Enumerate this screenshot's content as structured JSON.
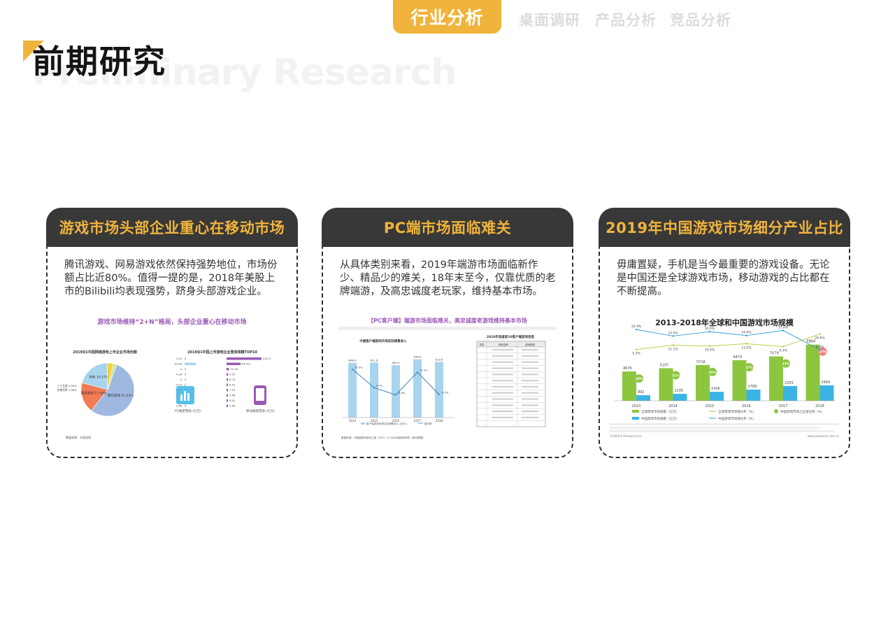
{
  "nav": {
    "active": "行业分析",
    "items": [
      "桌面调研",
      "产品分析",
      "竞品分析"
    ]
  },
  "header": {
    "title": "前期研究",
    "subtitle": "Preliminary Research"
  },
  "cards": [
    {
      "title": "游戏市场头部企业重心在移动市场",
      "text": "腾讯游戏、网易游戏依然保持强势地位，市场份额占比近80%。值得一提的是，2018年美股上市的Bilibili均表现强势，跻身头部游戏企业。",
      "figure": {
        "title": "游戏市场维持“2+N”格局，头部企业重心在移动市场",
        "left_title": "2019Q1中国网络游戏上市企业市场份额",
        "right_title": "2019Q1中国上市游戏企业营收规模TOP10",
        "pie_labels": [
          "腾讯游戏 51.53%",
          "网易游戏 17.45%",
          "其他 19.27%",
          "三七互娱 3.50%",
          "完美世界 1.98%"
        ],
        "bar_values": [
          "212.0",
          "85.44",
          "14.40",
          "9.20",
          "8.74",
          "6.01",
          "7.23",
          "3.58",
          "6.41",
          "3.65"
        ],
        "left_values": [
          "1.03",
          "33.06",
          "4",
          "4.26",
          "0",
          "2.03",
          "0.18",
          "4.15",
          "4",
          "2.68"
        ],
        "legend_pc": "PC端游营收 (亿元)",
        "legend_mobile": "移动端游营收 (亿元)",
        "source": "数据来源：艾瑞咨询"
      }
    },
    {
      "title": "PC端市场面临难关",
      "text": "从具体类别来看，2019年端游市场面临新作少、精品少的难关，18年末至今，仅靠优质的老牌端游，及高忠诚度老玩家，维持基本市场。",
      "figure": {
        "title": "【PC客户端】端游市场面临难关，高忠诚度老游戏维持基本市场",
        "chart_title": "中国客户端游戏市场实际销售收入",
        "table_title": "2018年热度前10客户端游戏信息",
        "table_headers": [
          "排名",
          "游戏名称",
          "游戏类型"
        ],
        "legend": [
          "客户端游戏市场实际销售收入 (亿元)",
          "增长率"
        ],
        "source": "数据来源：中国音数协游戏工委（GPC）& CNG中新游戏研究（伽马数据）"
      }
    },
    {
      "title": "2019年中国游戏市场细分产业占比",
      "text": "毋庸置疑，手机是当今最重要的游戏设备。无论是中国还是全球游戏市场，移动游戏的占比都在不断提高。",
      "figure": {
        "title": "2013-2018年全球和中国游戏市场规模",
        "legend": [
          "全球游戏市场规模（亿元）",
          "全球游戏市场增长率（%）",
          "中国游戏市场占全球比例（%）",
          "中国游戏市场规模（亿元）",
          "中国游戏市场增长率（%）"
        ],
        "footer": "©2019.6 iResearch Inc.",
        "footer_right": "www.iresearch.com.cn"
      }
    }
  ],
  "chart_data": [
    {
      "type": "pie",
      "title": "2019Q1中国网络游戏上市企业市场份额",
      "labels": [
        "腾讯游戏",
        "网易游戏",
        "其他",
        "三七互娱",
        "完美世界"
      ],
      "values": [
        51.53,
        17.45,
        19.27,
        3.5,
        1.98
      ]
    },
    {
      "type": "bar",
      "title": "中国客户端游戏市场实际销售收入",
      "categories": [
        "2014",
        "2015",
        "2016",
        "2017",
        "2018"
      ],
      "series": [
        {
          "name": "客户端游戏市场实际销售收入 (亿元)",
          "values": [
            608.9,
            611.6,
            582.5,
            648.6,
            619.6
          ]
        },
        {
          "name": "增长率",
          "values": [
            13.5,
            0.4,
            -4.8,
            11.4,
            -4.5
          ]
        }
      ],
      "ylim": [
        0,
        700
      ]
    },
    {
      "type": "bar",
      "title": "2013-2018年全球和中国游戏市场规模",
      "categories": [
        "2013",
        "2014",
        "2015",
        "2016",
        "2017",
        "2018"
      ],
      "series": [
        {
          "name": "全球游戏市场规模（亿元）",
          "values": [
            4676,
            5197,
            5718,
            6474,
            7079,
            8964
          ]
        },
        {
          "name": "中国游戏市场规模（亿元）",
          "values": [
            892,
            1105,
            1436,
            1789,
            2355,
            2464
          ]
        },
        {
          "name": "中国游戏市场占全球比例（%）",
          "values": [
            19,
            21,
            25,
            27,
            33,
            27
          ]
        },
        {
          "name": "全球游戏市场增长率（%）",
          "values": [
            5.2,
            11.1,
            10.0,
            13.2,
            9.3,
            26.6
          ]
        },
        {
          "name": "中国游戏市场增长率（%）",
          "values": [
            32.9,
            23.9,
            30.0,
            24.6,
            31.6,
            4.6
          ]
        }
      ],
      "ylim": [
        0,
        10000
      ]
    }
  ],
  "colors": {
    "accent": "#f0b43c",
    "card_header": "#383838",
    "ghost_text": "#f2f2f2",
    "purple": "#9b59b6",
    "light_blue": "#a8d4ee",
    "green": "#8cc63f",
    "cyan": "#3bb4e5"
  }
}
